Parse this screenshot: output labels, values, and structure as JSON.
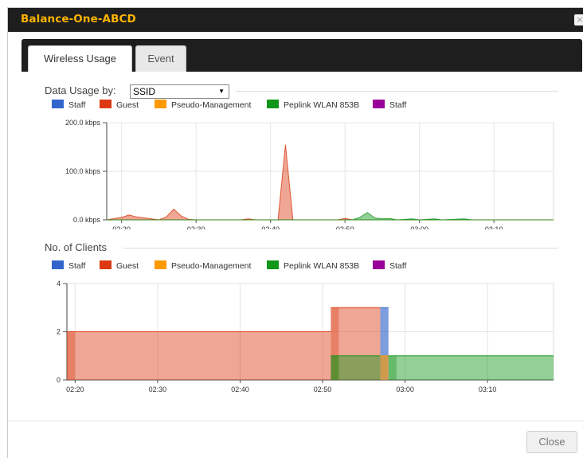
{
  "dialog": {
    "title": "Balance-One-ABCD",
    "close_glyph": "×"
  },
  "tabs": [
    {
      "label": "Wireless Usage",
      "active": true
    },
    {
      "label": "Event",
      "active": false
    }
  ],
  "usage": {
    "heading": "Data Usage by:",
    "select_value": "SSID",
    "select_arrow": "▼"
  },
  "clients": {
    "heading": "No. of Clients"
  },
  "legend": [
    {
      "label": "Staff",
      "color": "#3366cc"
    },
    {
      "label": "Guest",
      "color": "#dc3912"
    },
    {
      "label": "Pseudo-Management",
      "color": "#ff9900"
    },
    {
      "label": "Peplink WLAN 853B",
      "color": "#109618"
    },
    {
      "label": "Staff",
      "color": "#990099"
    }
  ],
  "footer": {
    "close_label": "Close"
  },
  "chart_data": [
    {
      "type": "area",
      "x_ticks": [
        "02:20",
        "02:30",
        "02:40",
        "02:50",
        "03:00",
        "03:10"
      ],
      "y_ticks": [
        "0.0 kbps",
        "100.0 kbps",
        "200.0 kbps"
      ],
      "ylim": [
        0,
        200
      ],
      "unit": "kbps",
      "grid": true,
      "legend_position": "top-left",
      "x_range": [
        "02:18",
        "03:18"
      ],
      "series": [
        {
          "name": "Guest",
          "color": "#dc3912",
          "points": [
            [
              "02:18",
              0
            ],
            [
              "02:20",
              5
            ],
            [
              "02:21",
              10
            ],
            [
              "02:22",
              6
            ],
            [
              "02:24",
              2
            ],
            [
              "02:25",
              0
            ],
            [
              "02:26",
              6
            ],
            [
              "02:27",
              22
            ],
            [
              "02:28",
              8
            ],
            [
              "02:29",
              1
            ],
            [
              "02:30",
              0
            ],
            [
              "02:36",
              0
            ],
            [
              "02:37",
              2
            ],
            [
              "02:38",
              0
            ],
            [
              "02:41",
              0
            ],
            [
              "02:42",
              155
            ],
            [
              "02:43",
              0
            ],
            [
              "02:49",
              0
            ],
            [
              "02:50",
              3
            ],
            [
              "02:51",
              0
            ],
            [
              "03:18",
              0
            ]
          ]
        },
        {
          "name": "Peplink WLAN 853B",
          "color": "#109618",
          "points": [
            [
              "02:18",
              0
            ],
            [
              "02:51",
              0
            ],
            [
              "02:52",
              5
            ],
            [
              "02:53",
              15
            ],
            [
              "02:54",
              4
            ],
            [
              "02:55",
              2
            ],
            [
              "02:56",
              3
            ],
            [
              "02:57",
              0
            ],
            [
              "02:59",
              2
            ],
            [
              "03:00",
              0
            ],
            [
              "03:02",
              2
            ],
            [
              "03:03",
              0
            ],
            [
              "03:06",
              2
            ],
            [
              "03:07",
              0
            ],
            [
              "03:18",
              0
            ]
          ]
        }
      ]
    },
    {
      "type": "area",
      "x_ticks": [
        "02:20",
        "02:30",
        "02:40",
        "02:50",
        "03:00",
        "03:10"
      ],
      "y_ticks": [
        "0",
        "2",
        "4"
      ],
      "ylim": [
        0,
        4
      ],
      "grid": true,
      "legend_position": "top-left",
      "x_range": [
        "02:19",
        "03:18"
      ],
      "segments": [
        {
          "series": "Guest",
          "color": "#dc3912",
          "from": "02:19",
          "to": "02:51",
          "value": 2
        },
        {
          "series": "Guest",
          "color": "#dc3912",
          "from": "02:51",
          "to": "02:57",
          "value": 3
        },
        {
          "series": "Staff",
          "color": "#3366cc",
          "from": "02:57",
          "to": "02:58",
          "value": 3
        },
        {
          "series": "Peplink WLAN 853B",
          "color": "#109618",
          "from": "02:51",
          "to": "02:57",
          "value": 1
        },
        {
          "series": "Pseudo-Management",
          "color": "#ff9900",
          "from": "02:57",
          "to": "02:58",
          "value": 1
        },
        {
          "series": "Peplink WLAN 853B",
          "color": "#109618",
          "from": "02:58",
          "to": "03:18",
          "value": 1
        }
      ]
    }
  ]
}
